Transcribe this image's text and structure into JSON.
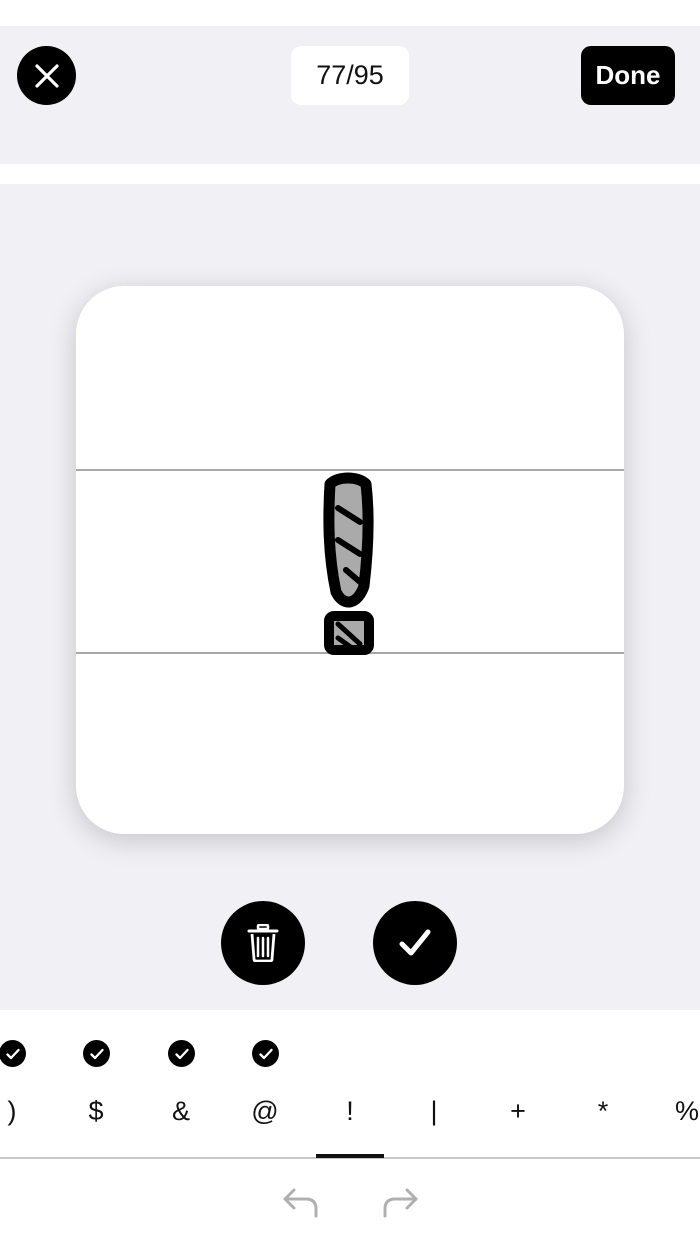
{
  "header": {
    "counter": "77/95",
    "done_label": "Done"
  },
  "characters": [
    {
      "label": ")",
      "done": true
    },
    {
      "label": "$",
      "done": true
    },
    {
      "label": "&",
      "done": true
    },
    {
      "label": "@",
      "done": true
    },
    {
      "label": "!",
      "done": false,
      "selected": true
    },
    {
      "label": "|",
      "done": false
    },
    {
      "label": "+",
      "done": false
    },
    {
      "label": "*",
      "done": false
    },
    {
      "label": "%",
      "done": false
    }
  ],
  "icons": {
    "close": "close-icon",
    "delete": "trash-icon",
    "accept": "check-icon",
    "undo": "undo-arrow-icon",
    "redo": "redo-arrow-icon"
  },
  "colors": {
    "background": "#f0f0f5",
    "accent": "#000000",
    "disabled": "#b0b0b0"
  }
}
